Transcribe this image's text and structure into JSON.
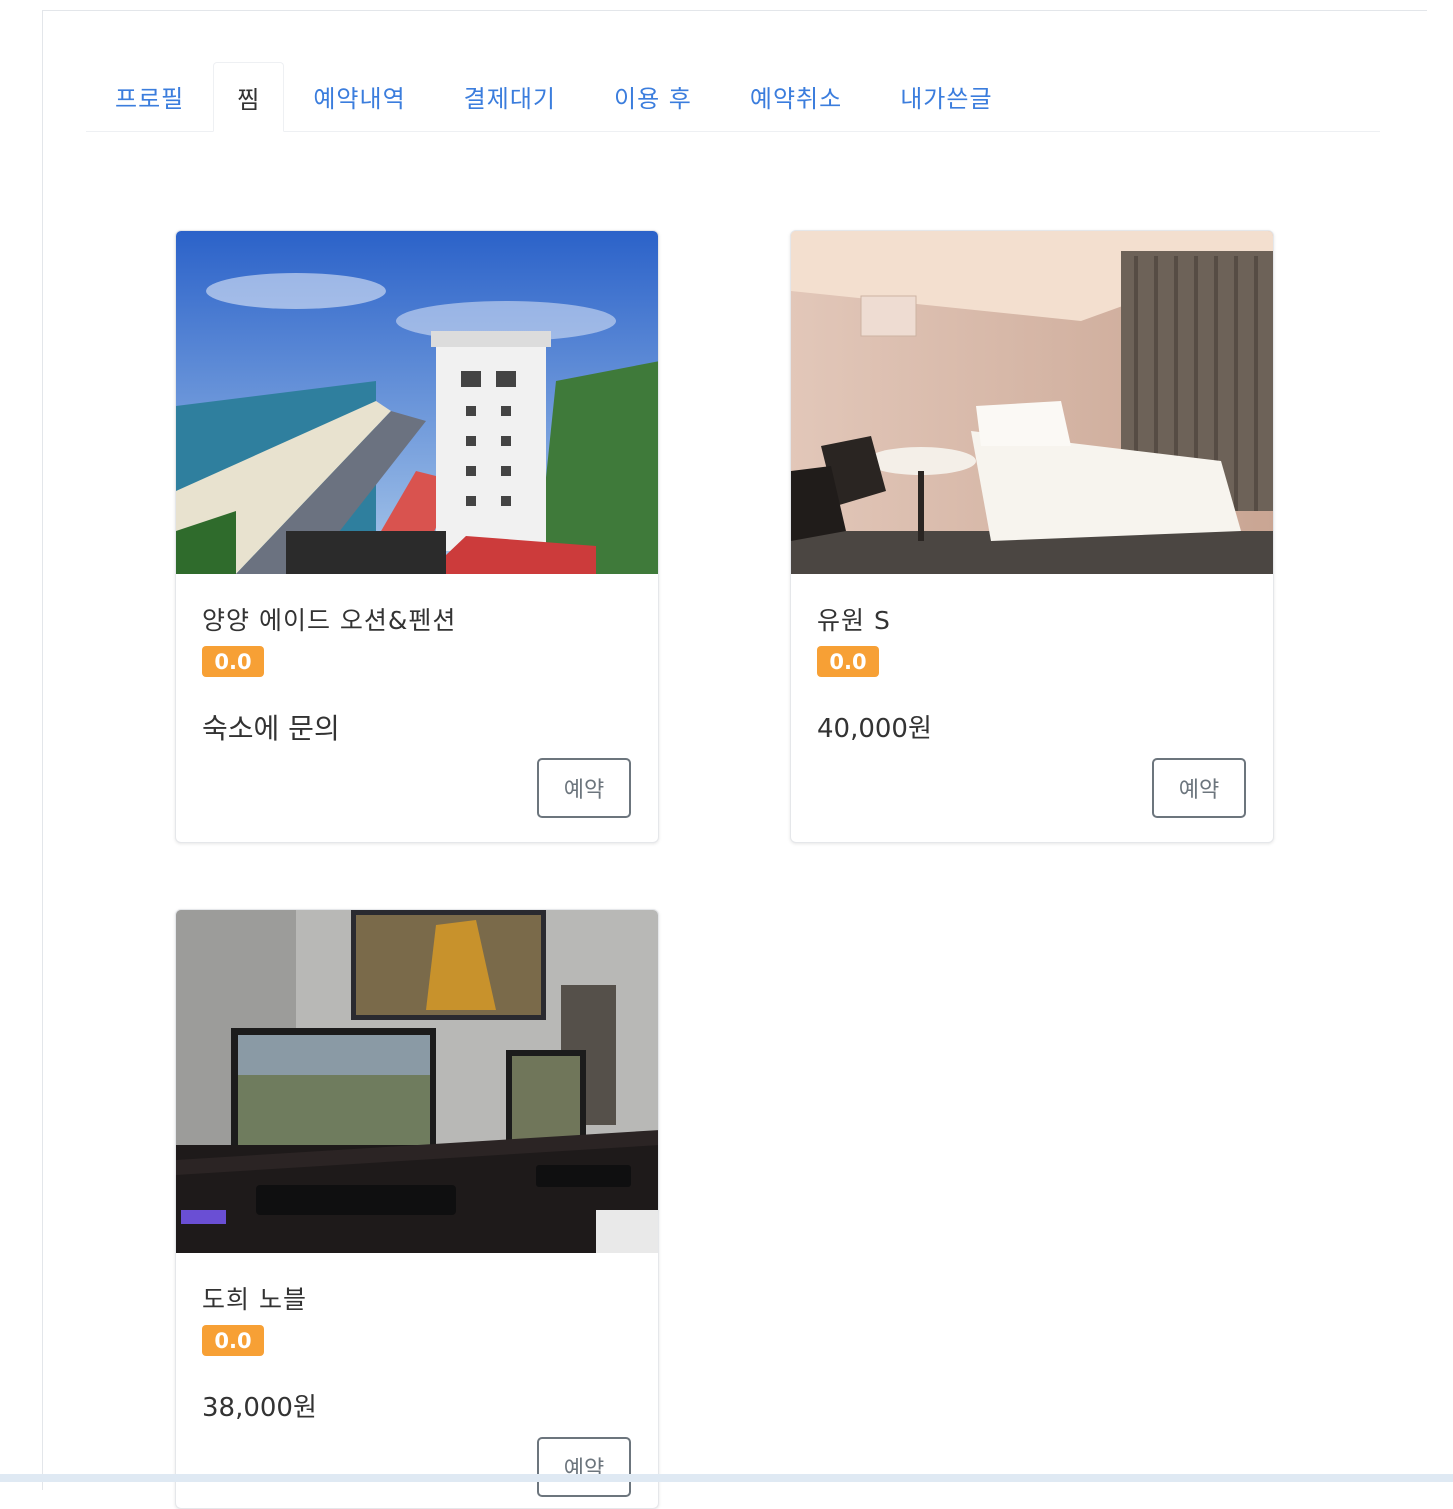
{
  "tabs": [
    {
      "label": "프로필",
      "active": false
    },
    {
      "label": "찜",
      "active": true
    },
    {
      "label": "예약내역",
      "active": false
    },
    {
      "label": "결제대기",
      "active": false
    },
    {
      "label": "이용 후",
      "active": false
    },
    {
      "label": "예약취소",
      "active": false
    },
    {
      "label": "내가쓴글",
      "active": false
    }
  ],
  "cards": [
    {
      "name": "양양 에이드 오션&펜션",
      "rating": "0.0",
      "price": "숙소에 문의",
      "book_label": "예약"
    },
    {
      "name": "유원 S",
      "rating": "0.0",
      "price": "40,000원",
      "book_label": "예약"
    },
    {
      "name": "도희 노블",
      "rating": "0.0",
      "price": "38,000원",
      "book_label": "예약"
    }
  ],
  "colors": {
    "accent": "#3b7ddd",
    "rating_badge": "#f7a035",
    "button_border": "#6c757d"
  }
}
